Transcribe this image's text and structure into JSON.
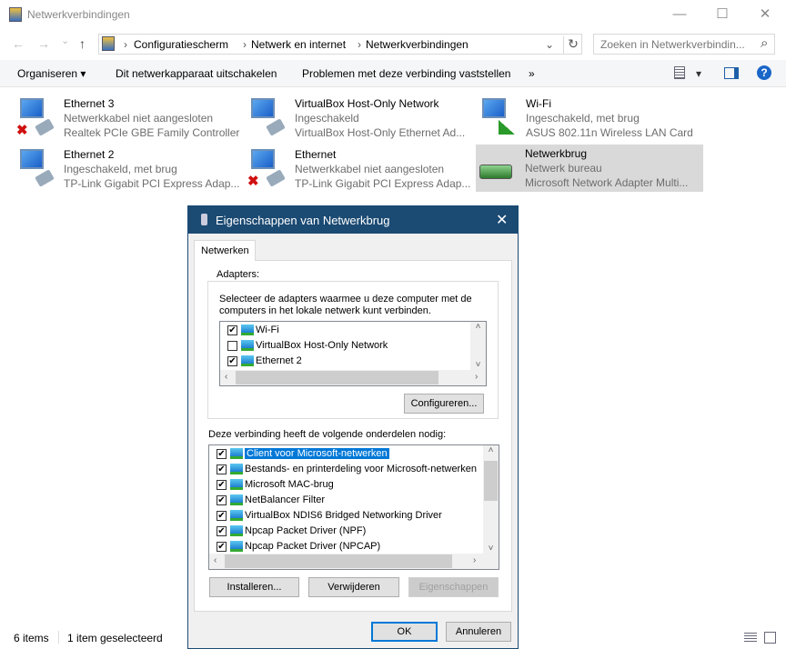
{
  "window": {
    "title": "Netwerkverbindingen",
    "minimize": "—",
    "maximize": "☐",
    "close": "✕"
  },
  "address": {
    "back": "←",
    "forward": "→",
    "recent": "⌄",
    "up": "↑",
    "crumbs": [
      "Configuratiescherm",
      "Netwerk en internet",
      "Netwerkverbindingen"
    ],
    "sep": "›",
    "dropdown": "⌄",
    "refresh": "↻"
  },
  "search": {
    "placeholder": "Zoeken in Netwerkverbindin...",
    "icon": "⌕"
  },
  "toolbar": {
    "organize": "Organiseren ▾",
    "disable": "Dit netwerkapparaat uitschakelen",
    "diagnose": "Problemen met deze verbinding vaststellen",
    "more": "»",
    "view": "▾",
    "help": "?"
  },
  "items": [
    {
      "name": "Ethernet 3",
      "status": "Netwerkkabel niet aangesloten",
      "device": "Realtek PCIe GBE Family Controller",
      "icon": "ethernet-disconnected"
    },
    {
      "name": "VirtualBox Host-Only Network",
      "status": "Ingeschakeld",
      "device": "VirtualBox Host-Only Ethernet Ad...",
      "icon": "ethernet"
    },
    {
      "name": "Wi-Fi",
      "status": "Ingeschakeld, met brug",
      "device": "ASUS 802.11n Wireless LAN Card",
      "icon": "wifi"
    },
    {
      "name": "Ethernet 2",
      "status": "Ingeschakeld, met brug",
      "device": "TP-Link Gigabit PCI Express Adap...",
      "icon": "ethernet"
    },
    {
      "name": "Ethernet",
      "status": "Netwerkkabel niet aangesloten",
      "device": "TP-Link Gigabit PCI Express Adap...",
      "icon": "ethernet-disconnected"
    },
    {
      "name": "Netwerkbrug",
      "status": "Netwerk bureau",
      "device": "Microsoft Network Adapter Multi...",
      "icon": "bridge"
    }
  ],
  "statusbar": {
    "count": "6 items",
    "selected": "1 item geselecteerd"
  },
  "dialog": {
    "title": "Eigenschappen van Netwerkbrug",
    "close": "✕",
    "tab": "Netwerken",
    "adapters_label": "Adapters:",
    "adapters_desc_1": "Selecteer de adapters waarmee u deze computer met de",
    "adapters_desc_2": "computers in het lokale netwerk kunt verbinden.",
    "adapters": [
      {
        "label": "Wi-Fi",
        "checked": "✔"
      },
      {
        "label": "VirtualBox Host-Only Network",
        "checked": ""
      },
      {
        "label": "Ethernet 2",
        "checked": "✔"
      }
    ],
    "configure": "Configureren...",
    "components_label": "Deze verbinding heeft de volgende onderdelen nodig:",
    "components": [
      {
        "label": "Client voor Microsoft-netwerken",
        "checked": "✔"
      },
      {
        "label": "Bestands- en printerdeling voor Microsoft-netwerken",
        "checked": "✔"
      },
      {
        "label": "Microsoft MAC-brug",
        "checked": "✔"
      },
      {
        "label": "NetBalancer Filter",
        "checked": "✔"
      },
      {
        "label": "VirtualBox NDIS6 Bridged Networking Driver",
        "checked": "✔"
      },
      {
        "label": "Npcap Packet Driver (NPF)",
        "checked": "✔"
      },
      {
        "label": "Npcap Packet Driver (NPCAP)",
        "checked": "✔"
      }
    ],
    "install": "Installeren...",
    "remove": "Verwijderen",
    "properties": "Eigenschappen",
    "ok": "OK",
    "cancel": "Annuleren",
    "scroll": {
      "up": "˄",
      "down": "˅",
      "left": "‹",
      "right": "›"
    }
  },
  "colors": {
    "dialog_title": "#1b4a73",
    "selection": "#0078d7",
    "selected_item": "#d9d9d9"
  }
}
